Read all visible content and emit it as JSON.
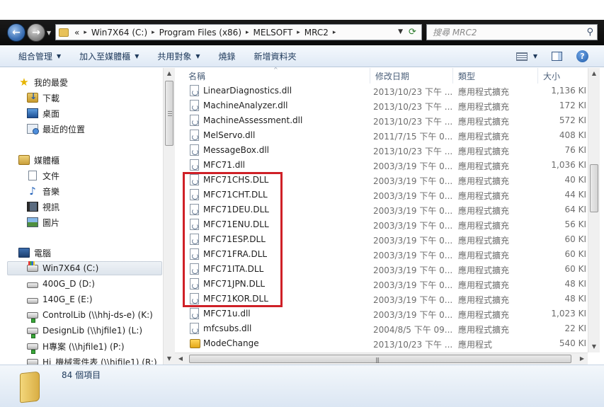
{
  "address": {
    "crumb_prefix": "«",
    "crumbs": [
      "Win7X64 (C:)",
      "Program Files (x86)",
      "MELSOFT",
      "MRC2"
    ],
    "search_placeholder": "搜尋 MRC2"
  },
  "toolbar": {
    "organize": "組合管理",
    "add_to_library": "加入至媒體櫃",
    "share_with": "共用對象",
    "burn": "燒錄",
    "new_folder": "新增資料夾"
  },
  "nav": {
    "favorites": {
      "label": "我的最愛",
      "items": [
        "下載",
        "桌面",
        "最近的位置"
      ]
    },
    "libraries": {
      "label": "媒體櫃",
      "items": [
        "文件",
        "音樂",
        "視訊",
        "圖片"
      ]
    },
    "computer": {
      "label": "電腦",
      "items": [
        "Win7X64 (C:)",
        "400G_D (D:)",
        "140G_E (E:)",
        "ControlLib (\\\\hhj-ds-e) (K:)",
        "DesignLib (\\\\hjfile1) (L:)",
        "H專案 (\\\\hjfile1) (P:)",
        "Hi_機械零件表 (\\\\hjfile1) (R:)"
      ],
      "selected_index": 0
    }
  },
  "columns": {
    "name": "名稱",
    "date": "修改日期",
    "type": "類型",
    "size": "大小"
  },
  "files": [
    {
      "name": "LinearDiagnostics.dll",
      "date": "2013/10/23 下午 ...",
      "type": "應用程式擴充",
      "size": "1,136 KI",
      "kind": "dll"
    },
    {
      "name": "MachineAnalyzer.dll",
      "date": "2013/10/23 下午 ...",
      "type": "應用程式擴充",
      "size": "172 KI",
      "kind": "dll"
    },
    {
      "name": "MachineAssessment.dll",
      "date": "2013/10/23 下午 ...",
      "type": "應用程式擴充",
      "size": "572 KI",
      "kind": "dll"
    },
    {
      "name": "MelServo.dll",
      "date": "2011/7/15 下午 0...",
      "type": "應用程式擴充",
      "size": "408 KI",
      "kind": "dll"
    },
    {
      "name": "MessageBox.dll",
      "date": "2013/10/23 下午 ...",
      "type": "應用程式擴充",
      "size": "76 KI",
      "kind": "dll"
    },
    {
      "name": "MFC71.dll",
      "date": "2003/3/19 下午 0...",
      "type": "應用程式擴充",
      "size": "1,036 KI",
      "kind": "dll"
    },
    {
      "name": "MFC71CHS.DLL",
      "date": "2003/3/19 下午 0...",
      "type": "應用程式擴充",
      "size": "40 KI",
      "kind": "dll"
    },
    {
      "name": "MFC71CHT.DLL",
      "date": "2003/3/19 下午 0...",
      "type": "應用程式擴充",
      "size": "44 KI",
      "kind": "dll"
    },
    {
      "name": "MFC71DEU.DLL",
      "date": "2003/3/19 下午 0...",
      "type": "應用程式擴充",
      "size": "64 KI",
      "kind": "dll"
    },
    {
      "name": "MFC71ENU.DLL",
      "date": "2003/3/19 下午 0...",
      "type": "應用程式擴充",
      "size": "56 KI",
      "kind": "dll"
    },
    {
      "name": "MFC71ESP.DLL",
      "date": "2003/3/19 下午 0...",
      "type": "應用程式擴充",
      "size": "60 KI",
      "kind": "dll"
    },
    {
      "name": "MFC71FRA.DLL",
      "date": "2003/3/19 下午 0...",
      "type": "應用程式擴充",
      "size": "60 KI",
      "kind": "dll"
    },
    {
      "name": "MFC71ITA.DLL",
      "date": "2003/3/19 下午 0...",
      "type": "應用程式擴充",
      "size": "60 KI",
      "kind": "dll"
    },
    {
      "name": "MFC71JPN.DLL",
      "date": "2003/3/19 下午 0...",
      "type": "應用程式擴充",
      "size": "48 KI",
      "kind": "dll"
    },
    {
      "name": "MFC71KOR.DLL",
      "date": "2003/3/19 下午 0...",
      "type": "應用程式擴充",
      "size": "48 KI",
      "kind": "dll"
    },
    {
      "name": "MFC71u.dll",
      "date": "2003/3/19 下午 0...",
      "type": "應用程式擴充",
      "size": "1,023 KI",
      "kind": "dll"
    },
    {
      "name": "mfcsubs.dll",
      "date": "2004/8/5 下午 09...",
      "type": "應用程式擴充",
      "size": "22 KI",
      "kind": "dll"
    },
    {
      "name": "ModeChange",
      "date": "2013/10/23 下午 ...",
      "type": "應用程式",
      "size": "540 KI",
      "kind": "exe"
    }
  ],
  "highlight_color": "#cf2027",
  "status": {
    "item_count": "84 個項目"
  },
  "colors": {
    "address_bar": "#111111",
    "toolbar": "#dfe9f5",
    "details_pane": "#dbe6f3"
  }
}
